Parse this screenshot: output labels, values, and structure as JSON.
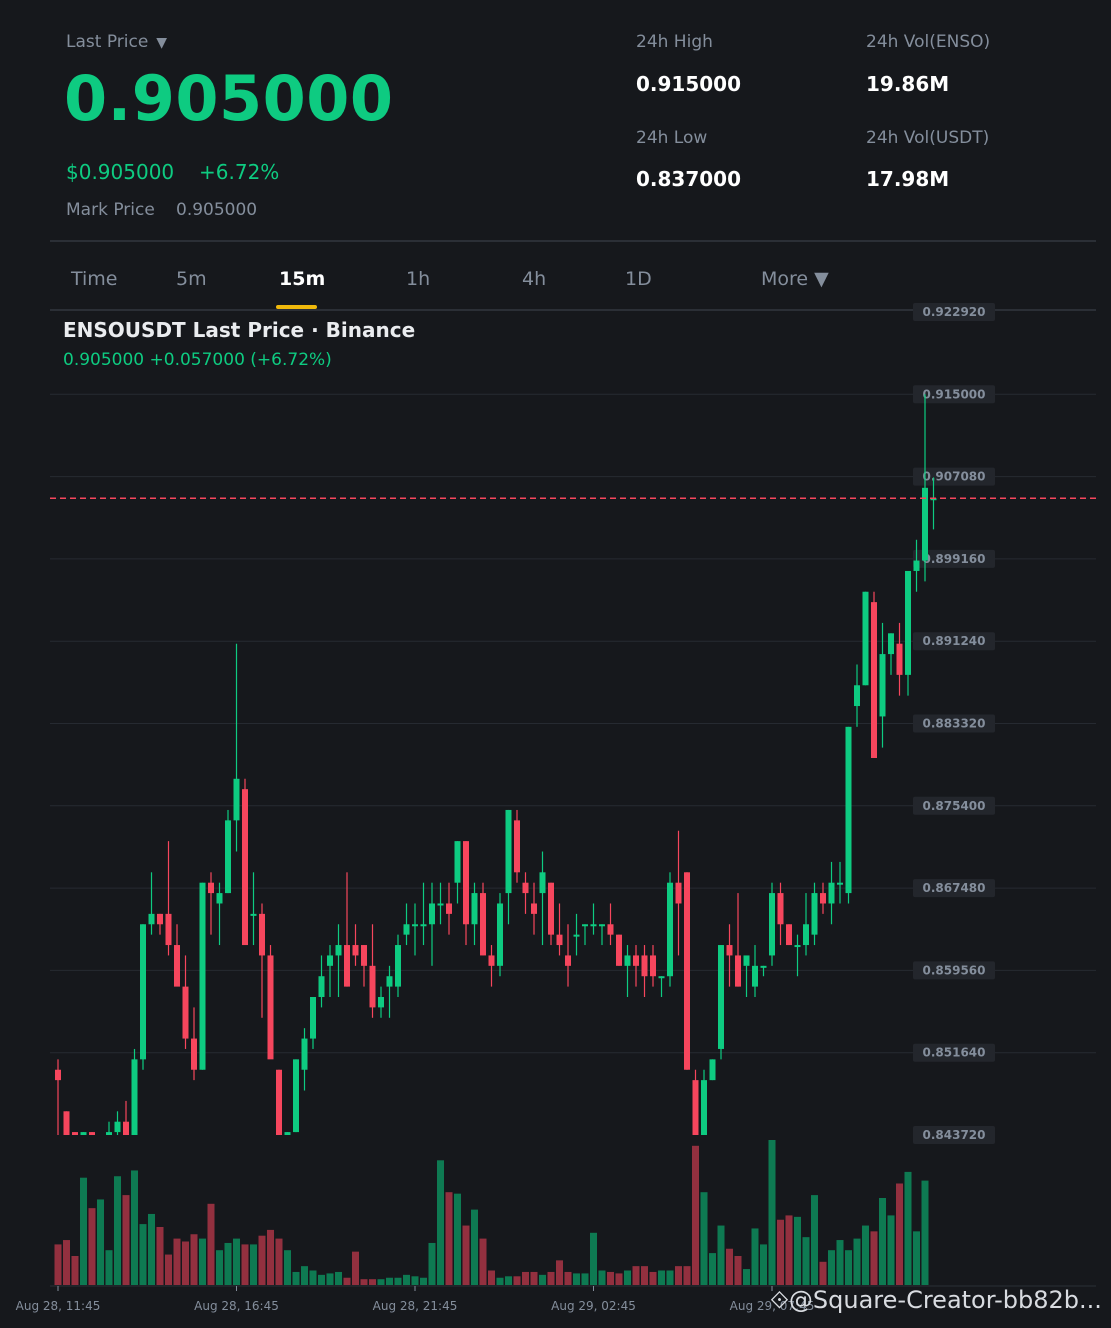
{
  "header": {
    "last_price_label": "Last Price",
    "last_price_caret": "▼",
    "last_price": "0.905000",
    "usd_price": "$0.905000",
    "change_pct": "+6.72%",
    "mark_price_label": "Mark Price",
    "mark_price": "0.905000"
  },
  "stats": {
    "high_label": "24h High",
    "high": "0.915000",
    "low_label": "24h Low",
    "low": "0.837000",
    "vol_enso_label": "24h Vol(ENSO)",
    "vol_enso": "19.86M",
    "vol_usdt_label": "24h Vol(USDT)",
    "vol_usdt": "17.98M"
  },
  "tabs": [
    {
      "label": "Time"
    },
    {
      "label": "5m"
    },
    {
      "label": "15m"
    },
    {
      "label": "1h"
    },
    {
      "label": "4h"
    },
    {
      "label": "1D"
    },
    {
      "label": "More ▼"
    }
  ],
  "active_tab": "15m",
  "chart_title": "ENSOUSDT Last Price · Binance",
  "chart_subtitle": "0.905000  +0.057000 (+6.72%)",
  "watermark": "@Square-Creator-bb82b...",
  "colors": {
    "up": "#0ecb81",
    "down": "#f6465d",
    "accent": "#f0b90b",
    "background": "#16181c"
  },
  "chart_data": {
    "type": "candlestick",
    "interval": "15m",
    "last_price_line": 0.905,
    "ylim": [
      0.84372,
      0.92292
    ],
    "y_ticks": [
      0.92292,
      0.915,
      0.90708,
      0.89916,
      0.89124,
      0.88332,
      0.8754,
      0.86748,
      0.85956,
      0.85164,
      0.84372
    ],
    "y_tick_labels": [
      "0.922920",
      "0.915000",
      "0.907080",
      "0.899160",
      "0.891240",
      "0.883320",
      "0.875400",
      "0.867480",
      "0.859560",
      "0.851640",
      "0.843720"
    ],
    "x_tick_labels": [
      "Aug 28, 11:45",
      "Aug 28, 16:45",
      "Aug 28, 21:45",
      "Aug 29, 02:45",
      "Aug 29, 07:45"
    ],
    "x_tick_index": [
      0,
      21,
      42,
      63,
      84
    ],
    "candles": [
      [
        0.85,
        0.851,
        0.843,
        0.849
      ],
      [
        0.846,
        0.846,
        0.843,
        0.843
      ],
      [
        0.844,
        0.844,
        0.843,
        0.843
      ],
      [
        0.843,
        0.844,
        0.843,
        0.844
      ],
      [
        0.844,
        0.844,
        0.843,
        0.843
      ],
      [
        0.843,
        0.843,
        0.842,
        0.843
      ],
      [
        0.843,
        0.845,
        0.843,
        0.844
      ],
      [
        0.844,
        0.846,
        0.843,
        0.845
      ],
      [
        0.845,
        0.847,
        0.843,
        0.843
      ],
      [
        0.843,
        0.852,
        0.842,
        0.851
      ],
      [
        0.851,
        0.864,
        0.85,
        0.864
      ],
      [
        0.864,
        0.869,
        0.863,
        0.865
      ],
      [
        0.865,
        0.865,
        0.863,
        0.864
      ],
      [
        0.865,
        0.872,
        0.861,
        0.862
      ],
      [
        0.862,
        0.864,
        0.86,
        0.858
      ],
      [
        0.858,
        0.861,
        0.852,
        0.853
      ],
      [
        0.853,
        0.856,
        0.849,
        0.85
      ],
      [
        0.85,
        0.868,
        0.85,
        0.868
      ],
      [
        0.868,
        0.869,
        0.863,
        0.867
      ],
      [
        0.866,
        0.868,
        0.862,
        0.867
      ],
      [
        0.867,
        0.875,
        0.867,
        0.874
      ],
      [
        0.874,
        0.891,
        0.871,
        0.878
      ],
      [
        0.877,
        0.878,
        0.862,
        0.862
      ],
      [
        0.865,
        0.869,
        0.862,
        0.865
      ],
      [
        0.865,
        0.866,
        0.855,
        0.861
      ],
      [
        0.861,
        0.862,
        0.852,
        0.851
      ],
      [
        0.85,
        0.85,
        0.841,
        0.841
      ],
      [
        0.84,
        0.844,
        0.832,
        0.844
      ],
      [
        0.844,
        0.851,
        0.844,
        0.851
      ],
      [
        0.85,
        0.854,
        0.848,
        0.853
      ],
      [
        0.853,
        0.857,
        0.852,
        0.857
      ],
      [
        0.857,
        0.861,
        0.856,
        0.859
      ],
      [
        0.86,
        0.862,
        0.857,
        0.861
      ],
      [
        0.861,
        0.864,
        0.857,
        0.862
      ],
      [
        0.862,
        0.869,
        0.858,
        0.858
      ],
      [
        0.862,
        0.864,
        0.86,
        0.861
      ],
      [
        0.862,
        0.862,
        0.858,
        0.86
      ],
      [
        0.86,
        0.864,
        0.855,
        0.856
      ],
      [
        0.856,
        0.858,
        0.855,
        0.857
      ],
      [
        0.858,
        0.86,
        0.855,
        0.859
      ],
      [
        0.858,
        0.863,
        0.857,
        0.862
      ],
      [
        0.863,
        0.866,
        0.862,
        0.864
      ],
      [
        0.864,
        0.866,
        0.861,
        0.864
      ],
      [
        0.864,
        0.868,
        0.862,
        0.864
      ],
      [
        0.864,
        0.868,
        0.86,
        0.866
      ],
      [
        0.866,
        0.868,
        0.864,
        0.866
      ],
      [
        0.866,
        0.868,
        0.863,
        0.865
      ],
      [
        0.868,
        0.872,
        0.866,
        0.872
      ],
      [
        0.872,
        0.872,
        0.862,
        0.864
      ],
      [
        0.864,
        0.868,
        0.862,
        0.867
      ],
      [
        0.867,
        0.868,
        0.861,
        0.861
      ],
      [
        0.861,
        0.862,
        0.858,
        0.86
      ],
      [
        0.86,
        0.867,
        0.859,
        0.866
      ],
      [
        0.867,
        0.875,
        0.864,
        0.875
      ],
      [
        0.874,
        0.875,
        0.868,
        0.869
      ],
      [
        0.868,
        0.869,
        0.865,
        0.867
      ],
      [
        0.866,
        0.868,
        0.863,
        0.865
      ],
      [
        0.867,
        0.871,
        0.862,
        0.869
      ],
      [
        0.868,
        0.868,
        0.862,
        0.863
      ],
      [
        0.863,
        0.866,
        0.861,
        0.862
      ],
      [
        0.861,
        0.864,
        0.858,
        0.86
      ],
      [
        0.863,
        0.865,
        0.861,
        0.863
      ],
      [
        0.864,
        0.864,
        0.862,
        0.864
      ],
      [
        0.864,
        0.866,
        0.863,
        0.864
      ],
      [
        0.864,
        0.864,
        0.862,
        0.864
      ],
      [
        0.864,
        0.866,
        0.862,
        0.863
      ],
      [
        0.863,
        0.863,
        0.86,
        0.86
      ],
      [
        0.86,
        0.862,
        0.857,
        0.861
      ],
      [
        0.861,
        0.862,
        0.858,
        0.86
      ],
      [
        0.861,
        0.862,
        0.857,
        0.859
      ],
      [
        0.861,
        0.862,
        0.858,
        0.859
      ],
      [
        0.859,
        0.859,
        0.857,
        0.859
      ],
      [
        0.859,
        0.869,
        0.858,
        0.868
      ],
      [
        0.868,
        0.873,
        0.861,
        0.866
      ],
      [
        0.869,
        0.869,
        0.85,
        0.85
      ],
      [
        0.849,
        0.85,
        0.841,
        0.843
      ],
      [
        0.843,
        0.85,
        0.843,
        0.849
      ],
      [
        0.849,
        0.851,
        0.849,
        0.851
      ],
      [
        0.852,
        0.862,
        0.851,
        0.862
      ],
      [
        0.862,
        0.864,
        0.858,
        0.861
      ],
      [
        0.861,
        0.867,
        0.858,
        0.858
      ],
      [
        0.86,
        0.86,
        0.857,
        0.861
      ],
      [
        0.858,
        0.862,
        0.857,
        0.86
      ],
      [
        0.86,
        0.86,
        0.859,
        0.86
      ],
      [
        0.861,
        0.868,
        0.86,
        0.867
      ],
      [
        0.867,
        0.868,
        0.862,
        0.864
      ],
      [
        0.864,
        0.864,
        0.862,
        0.862
      ],
      [
        0.862,
        0.863,
        0.859,
        0.862
      ],
      [
        0.862,
        0.867,
        0.861,
        0.864
      ],
      [
        0.863,
        0.868,
        0.862,
        0.867
      ],
      [
        0.867,
        0.868,
        0.865,
        0.866
      ],
      [
        0.866,
        0.87,
        0.864,
        0.868
      ],
      [
        0.868,
        0.87,
        0.866,
        0.868
      ],
      [
        0.867,
        0.883,
        0.866,
        0.883
      ],
      [
        0.885,
        0.889,
        0.883,
        0.887
      ],
      [
        0.887,
        0.896,
        0.887,
        0.896
      ],
      [
        0.895,
        0.896,
        0.88,
        0.88
      ],
      [
        0.884,
        0.893,
        0.881,
        0.89
      ],
      [
        0.89,
        0.892,
        0.888,
        0.892
      ],
      [
        0.891,
        0.893,
        0.886,
        0.888
      ],
      [
        0.888,
        0.894,
        0.886,
        0.898
      ],
      [
        0.898,
        0.901,
        0.896,
        0.899
      ],
      [
        0.899,
        0.915,
        0.897,
        0.906
      ],
      [
        0.905,
        0.907,
        0.902,
        0.905
      ]
    ],
    "volume": [
      28,
      31,
      20,
      74,
      53,
      59,
      24,
      75,
      62,
      79,
      42,
      49,
      40,
      21,
      32,
      30,
      35,
      32,
      56,
      24,
      29,
      32,
      28,
      28,
      34,
      38,
      32,
      24,
      9,
      13,
      10,
      7,
      8,
      9,
      5,
      23,
      4,
      4,
      4,
      5,
      5,
      7,
      6,
      5,
      29,
      86,
      64,
      63,
      41,
      52,
      32,
      10,
      5,
      6,
      6,
      9,
      9,
      7,
      9,
      17,
      9,
      8,
      8,
      36,
      10,
      9,
      8,
      10,
      13,
      13,
      9,
      10,
      10,
      13,
      13,
      96,
      64,
      22,
      41,
      25,
      20,
      11,
      39,
      28,
      100,
      45,
      48,
      47,
      33,
      62,
      16,
      24,
      31,
      24,
      32,
      41,
      37,
      60,
      48,
      70,
      78,
      37,
      72
    ]
  }
}
